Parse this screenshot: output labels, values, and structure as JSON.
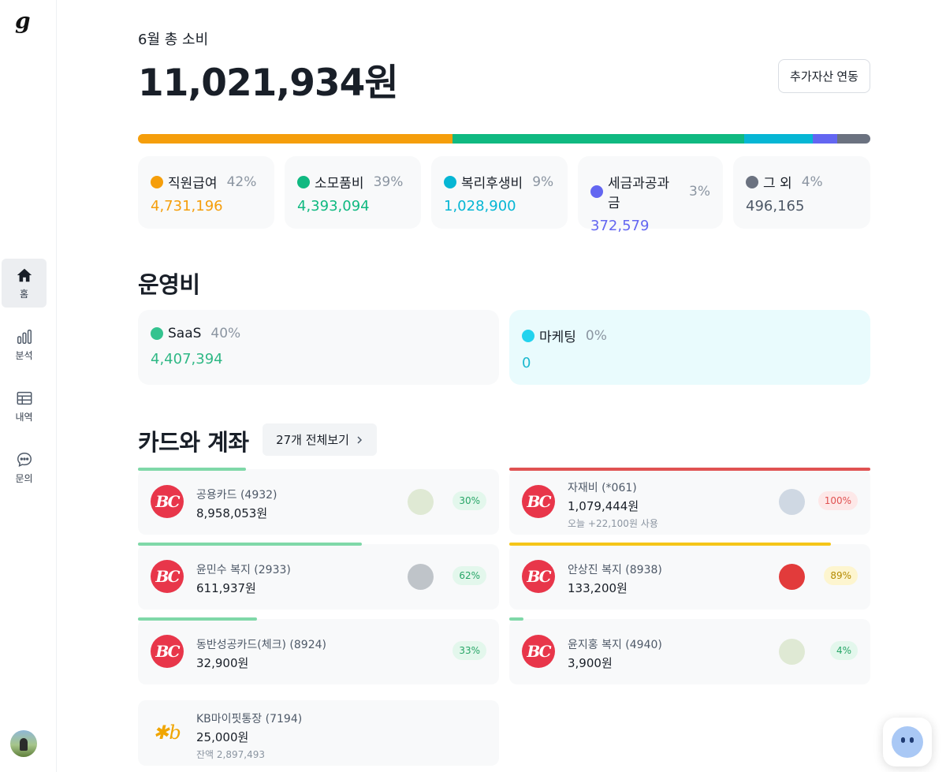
{
  "sidebar": {
    "logo": "g",
    "items": [
      {
        "label": "홈",
        "icon": "home-icon",
        "active": true
      },
      {
        "label": "분석",
        "icon": "bar-chart-icon",
        "active": false
      },
      {
        "label": "내역",
        "icon": "table-icon",
        "active": false
      },
      {
        "label": "문의",
        "icon": "chat-bubble-icon",
        "active": false
      }
    ]
  },
  "header": {
    "month_label": "6월 총 소비",
    "total": "11,021,934원",
    "link_button": "추가자산 연동"
  },
  "categories": [
    {
      "name": "직원급여",
      "pct": "42%",
      "value": "4,731,196",
      "share": 42.9,
      "color": "#f59e0b"
    },
    {
      "name": "소모품비",
      "pct": "39%",
      "value": "4,393,094",
      "share": 39.9,
      "color": "#10b981"
    },
    {
      "name": "복리후생비",
      "pct": "9%",
      "value": "1,028,900",
      "share": 9.3,
      "color": "#06b6d4"
    },
    {
      "name": "세금과공과금",
      "pct": "3%",
      "value": "372,579",
      "share": 3.4,
      "color": "#6366f1"
    },
    {
      "name": "그 외",
      "pct": "4%",
      "value": "496,165",
      "share": 4.5,
      "color": "#6b7280"
    }
  ],
  "operating": {
    "title": "운영비",
    "items": [
      {
        "name": "SaaS",
        "pct": "40%",
        "value": "4,407,394",
        "color": "#34c38f",
        "bg": "#f8f9fa",
        "text_color": "#2fb885"
      },
      {
        "name": "마케팅",
        "pct": "0%",
        "value": "0",
        "color": "#22d3ee",
        "bg": "#e9fbfd",
        "text_color": "#1ab8cf"
      }
    ]
  },
  "cards_section": {
    "title": "카드와 계좌",
    "view_all": "27개 전체보기"
  },
  "cards": [
    {
      "name": "공용카드 (4932)",
      "amount": "8,958,053원",
      "sub": "",
      "usage": 30,
      "badge": "30%",
      "bar_color": "#7fd8a8",
      "badge_bg": "#e3f7ec",
      "badge_color": "#27a567",
      "logo": "BC",
      "avatar": true
    },
    {
      "name": "자재비 (*061)",
      "amount": "1,079,444원",
      "sub": "오늘 +22,100원 사용",
      "usage": 100,
      "badge": "100%",
      "bar_color": "#e05252",
      "badge_bg": "#fde8e8",
      "badge_color": "#e05252",
      "logo": "BC",
      "avatar": true
    },
    {
      "name": "윤민수 복지 (2933)",
      "amount": "611,937원",
      "sub": "",
      "usage": 62,
      "badge": "62%",
      "bar_color": "#7fd8a8",
      "badge_bg": "#e3f7ec",
      "badge_color": "#27a567",
      "logo": "BC",
      "avatar": true
    },
    {
      "name": "안상진 복지 (8938)",
      "amount": "133,200원",
      "sub": "",
      "usage": 89,
      "badge": "89%",
      "bar_color": "#f5c518",
      "badge_bg": "#fdf5cf",
      "badge_color": "#b48a00",
      "logo": "BC",
      "avatar": true
    },
    {
      "name": "동반성공카드(체크) (8924)",
      "amount": "32,900원",
      "sub": "",
      "usage": 33,
      "badge": "33%",
      "bar_color": "#7fd8a8",
      "badge_bg": "#e3f7ec",
      "badge_color": "#27a567",
      "logo": "BC",
      "avatar": false
    },
    {
      "name": "윤지홍 복지 (4940)",
      "amount": "3,900원",
      "sub": "",
      "usage": 4,
      "badge": "4%",
      "bar_color": "#7fd8a8",
      "badge_bg": "#e3f7ec",
      "badge_color": "#27a567",
      "logo": "BC",
      "avatar": true
    },
    {
      "name": "KB마이핏통장 (7194)",
      "amount": "25,000원",
      "sub": "잔액 2,897,493",
      "usage": 0,
      "badge": "",
      "bar_color": "",
      "badge_bg": "",
      "badge_color": "",
      "logo": "KB",
      "avatar": false
    }
  ]
}
